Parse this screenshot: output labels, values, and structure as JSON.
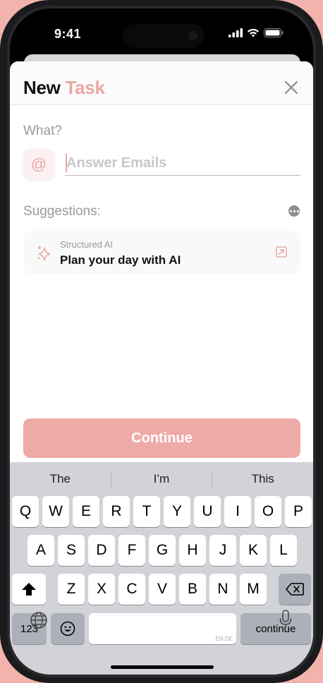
{
  "status_bar": {
    "time": "9:41",
    "icons": [
      "cellular-signal-icon",
      "wifi-icon",
      "battery-icon"
    ]
  },
  "header": {
    "title_part1": "New",
    "title_part2": "Task",
    "close_icon": "close-icon"
  },
  "form": {
    "what_label": "What?",
    "at_symbol": "@",
    "task_input_value": "",
    "task_input_placeholder": "Answer Emails"
  },
  "suggestions": {
    "label": "Suggestions:",
    "more_icon": "ellipsis-circle-icon",
    "items": [
      {
        "category": "Structured AI",
        "title": "Plan your day with AI",
        "icon": "sparkle-icon",
        "action_icon": "open-external-icon"
      }
    ]
  },
  "continue_button": {
    "label": "Continue"
  },
  "keyboard": {
    "predictions": [
      "The",
      "I’m",
      "This"
    ],
    "row1": [
      "Q",
      "W",
      "E",
      "R",
      "T",
      "Y",
      "U",
      "I",
      "O",
      "P"
    ],
    "row2": [
      "A",
      "S",
      "D",
      "F",
      "G",
      "H",
      "J",
      "K",
      "L"
    ],
    "row3": [
      "Z",
      "X",
      "C",
      "V",
      "B",
      "N",
      "M"
    ],
    "numbers_label": "123",
    "space_hint": "EN DE",
    "return_label": "continue",
    "shift_icon": "shift-icon",
    "delete_icon": "backspace-icon",
    "emoji_icon": "emoji-icon",
    "globe_icon": "globe-icon",
    "mic_icon": "microphone-icon"
  },
  "colors": {
    "accent": "#eba7a2",
    "button": "#eeaaa6",
    "background": "#f2b3ad"
  }
}
